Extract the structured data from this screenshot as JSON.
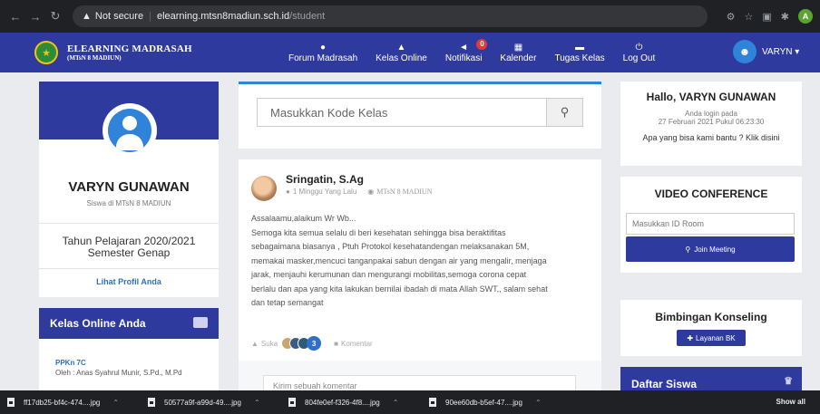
{
  "browser": {
    "security_label": "Not secure",
    "url_host": "elearning.mtsn8madiun.sch.id",
    "url_path": "/student",
    "profile_initial": "A"
  },
  "navbar": {
    "brand_title": "ELEARNING MADRASAH",
    "brand_subtitle": "(MTsN 8 MADIUN)",
    "menu": [
      {
        "label": "Forum Madrasah",
        "icon": "comments-icon"
      },
      {
        "label": "Kelas Online",
        "icon": "graduation-cap-icon"
      },
      {
        "label": "Notifikasi",
        "icon": "bullhorn-icon",
        "badge": "0"
      },
      {
        "label": "Kalender",
        "icon": "calendar-icon"
      },
      {
        "label": "Tugas Kelas",
        "icon": "folder-icon"
      },
      {
        "label": "Log Out",
        "icon": "power-icon"
      }
    ],
    "user_label": "VARYN"
  },
  "profile": {
    "name": "VARYN GUNAWAN",
    "role": "Siswa di MTsN 8 MADIUN",
    "year": "Tahun Pelajaran 2020/2021",
    "semester": "Semester Genap",
    "link": "Lihat Profil Anda"
  },
  "kelas": {
    "title": "Kelas Online Anda",
    "items": [
      {
        "title": "PPKn 7C",
        "teacher": "Oleh : Anas Syahrul Munir, S.Pd., M.Pd"
      }
    ]
  },
  "search": {
    "placeholder": "Masukkan Kode Kelas"
  },
  "post": {
    "author": "Sringatin, S.Ag",
    "time": "1 Minggu Yang Lalu",
    "school": "MTsN 8 MADIUN",
    "body_lines": [
      "Assalaamu,alaikum Wr Wb...",
      "Semoga kita semua selalu di beri kesehatan sehingga bisa beraktifitas",
      "sebagaimana biasanya , Ptuh Protokol kesehatandengan melaksanakan 5M,",
      "memakai masker,mencuci tanganpakai sabun dengan air yang mengalir, menjaga",
      "jarak, menjauhi kerumunan dan mengurangi mobilitas,semoga corona cepat",
      "berlalu dan apa yang kita lakukan bernilai ibadah di mata Allah SWT,, salam sehat",
      "dan tetap semangat"
    ],
    "like_label": "Suka",
    "like_count": "3",
    "comment_label": "Komentar",
    "comment_placeholder": "Kirim sebuah komentar"
  },
  "hello": {
    "title": "Hallo, VARYN GUNAWAN",
    "login_label": "Anda login pada",
    "login_date": "27 Februari 2021 Pukul 06:23:30",
    "help": "Apa yang bisa kami bantu ? Klik disini"
  },
  "video_conference": {
    "title": "VIDEO CONFERENCE",
    "placeholder": "Masukkan ID Room",
    "button": "Join Meeting"
  },
  "bimbingan": {
    "title": "Bimbingan Konseling",
    "button": "Layanan BK"
  },
  "daftar_siswa": {
    "title": "Daftar Siswa"
  },
  "downloads": {
    "items": [
      "ff17db25-bf4c-474....jpg",
      "50577a9f-a99d-49....jpg",
      "804fe0ef-f326-4f8....jpg",
      "90ee60db-b5ef-47....jpg"
    ],
    "show_all": "Show all"
  }
}
